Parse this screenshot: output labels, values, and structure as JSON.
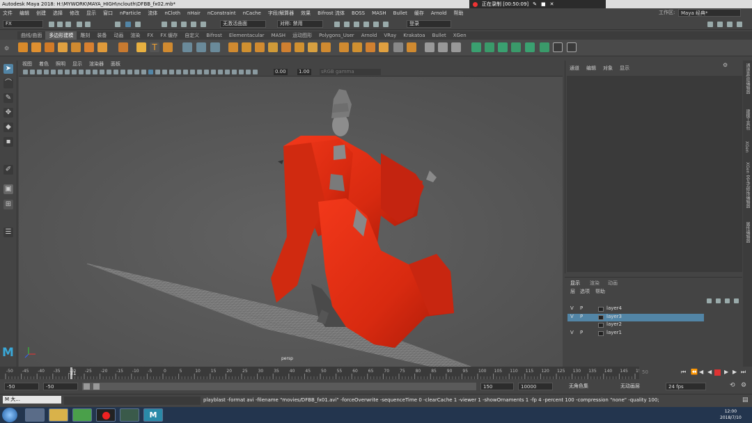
{
  "title": "Autodesk Maya 2018: H:\\MYWORK\\MAYA_HIGH\\nclouth\\DFBB_fx02.mb*",
  "recording": {
    "label": "正在录制 [00:50:09]"
  },
  "menus": [
    "文件",
    "编辑",
    "创建",
    "选择",
    "修改",
    "显示",
    "窗口",
    "nParticle",
    "流体",
    "nCloth",
    "nHair",
    "nConstraint",
    "nCache",
    "字段/解算器",
    "效果",
    "Bifrost 流体",
    "BOSS",
    "MASH",
    "Bullet",
    "缓存",
    "Arnold",
    "帮助"
  ],
  "workspace": {
    "label": "工作区:",
    "value": "Maya 经典*"
  },
  "status": {
    "mode": "FX",
    "live_surface": "无激活曲面",
    "symmetry": "对称: 禁用",
    "login": "登录"
  },
  "shelf_tabs": [
    "曲线/曲面",
    "多边形建模",
    "雕刻",
    "装备",
    "动画",
    "渲染",
    "FX",
    "FX 缓存",
    "自定义",
    "Bifrost",
    "Elementacular",
    "MASH",
    "运动图形",
    "Polygons_User",
    "Arnold",
    "VRay",
    "Krakatoa",
    "Bullet",
    "XGen"
  ],
  "active_shelf": "多边形建模",
  "viewport": {
    "menus": [
      "视图",
      "着色",
      "照明",
      "显示",
      "渲染器",
      "面板"
    ],
    "near": "0.00",
    "gain": "1.00",
    "color_space": "sRGB gamma",
    "camera": "persp"
  },
  "channel_box": {
    "tabs": [
      "通道",
      "编辑",
      "对象",
      "显示"
    ]
  },
  "right_strip": [
    "通道盒/层编辑器",
    "建模工具包",
    "XGen",
    "XGen 交互式修饰编辑器",
    "属性编辑器"
  ],
  "layer_editor": {
    "tabs": [
      "显示",
      "渲染",
      "动画"
    ],
    "menus": [
      "层",
      "选项",
      "帮助"
    ],
    "layers": [
      {
        "v": "V",
        "p": "P",
        "name": "layer4",
        "selected": false
      },
      {
        "v": "V",
        "p": "P",
        "name": "layer3",
        "selected": true
      },
      {
        "v": "",
        "p": "",
        "name": "layer2",
        "selected": false
      },
      {
        "v": "V",
        "p": "P",
        "name": "layer1",
        "selected": false
      }
    ]
  },
  "timeline": {
    "ticks": [
      "-50",
      "-45",
      "-40",
      "-35",
      "-30",
      "-25",
      "-20",
      "-15",
      "-10",
      "-5",
      "0",
      "5",
      "10",
      "15",
      "20",
      "25",
      "30",
      "35",
      "40",
      "45",
      "50",
      "55",
      "60",
      "65",
      "70",
      "75",
      "80",
      "85",
      "90",
      "95",
      "100",
      "105",
      "110",
      "115",
      "120",
      "125",
      "130",
      "135",
      "140",
      "145",
      "150"
    ],
    "current_frame": "-31",
    "end_frame_label": "50"
  },
  "range": {
    "start": "-50",
    "anim_start": "-50",
    "anim_end": "150",
    "end": "10000",
    "character": "无角色集",
    "anim_layer": "无动画层",
    "fps": "24 fps"
  },
  "command": {
    "language": "MEL",
    "label_short": "M 大...",
    "text": "playblast  -format avi -filename \"movies/DFBB_fx01.avi\" -forceOverwrite  -sequenceTime 0 -clearCache 1 -viewer 1 -showOrnaments 1 -fp 4 -percent 100 -compression \"none\" -quality 100;"
  },
  "clock": {
    "time": "12:00",
    "date": "2018/7/10"
  },
  "colors": {
    "robe": "#e02a10",
    "accent": "#5285a6"
  }
}
